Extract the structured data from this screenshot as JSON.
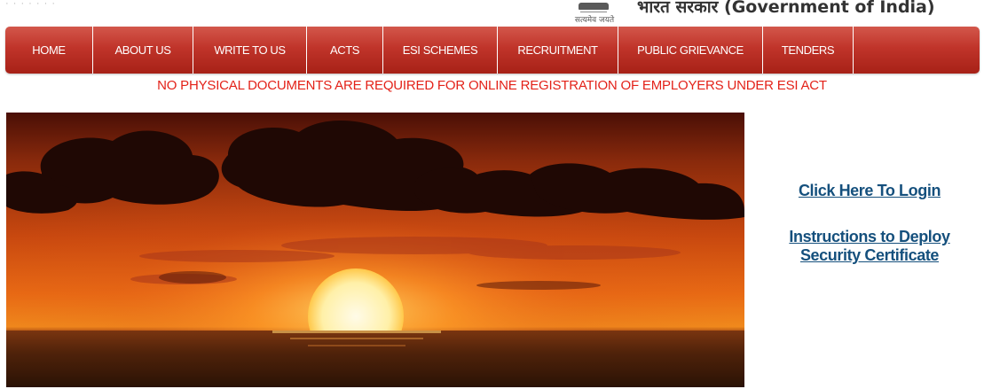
{
  "header": {
    "faint_text": "· · · · · · ·",
    "emblem_motto": "सत्यमेव जयते",
    "gov_title": "भारत सरकार (Government of India)"
  },
  "nav": {
    "items": [
      {
        "label": "HOME"
      },
      {
        "label": "ABOUT US"
      },
      {
        "label": "WRITE TO US"
      },
      {
        "label": "ACTS"
      },
      {
        "label": "ESI SCHEMES"
      },
      {
        "label": "RECRUITMENT"
      },
      {
        "label": "PUBLIC GRIEVANCE"
      },
      {
        "label": "TENDERS"
      }
    ],
    "color": "#c0342a"
  },
  "notice": {
    "text": "NO PHYSICAL DOCUMENTS ARE REQUIRED FOR ONLINE REGISTRATION OF EMPLOYERS UNDER ESI ACT",
    "color": "#e32219"
  },
  "side_links": {
    "login": "Click Here To Login",
    "deploy_line1": "Instructions to Deploy",
    "deploy_line2": "Security Certificate",
    "color": "#15507d"
  }
}
